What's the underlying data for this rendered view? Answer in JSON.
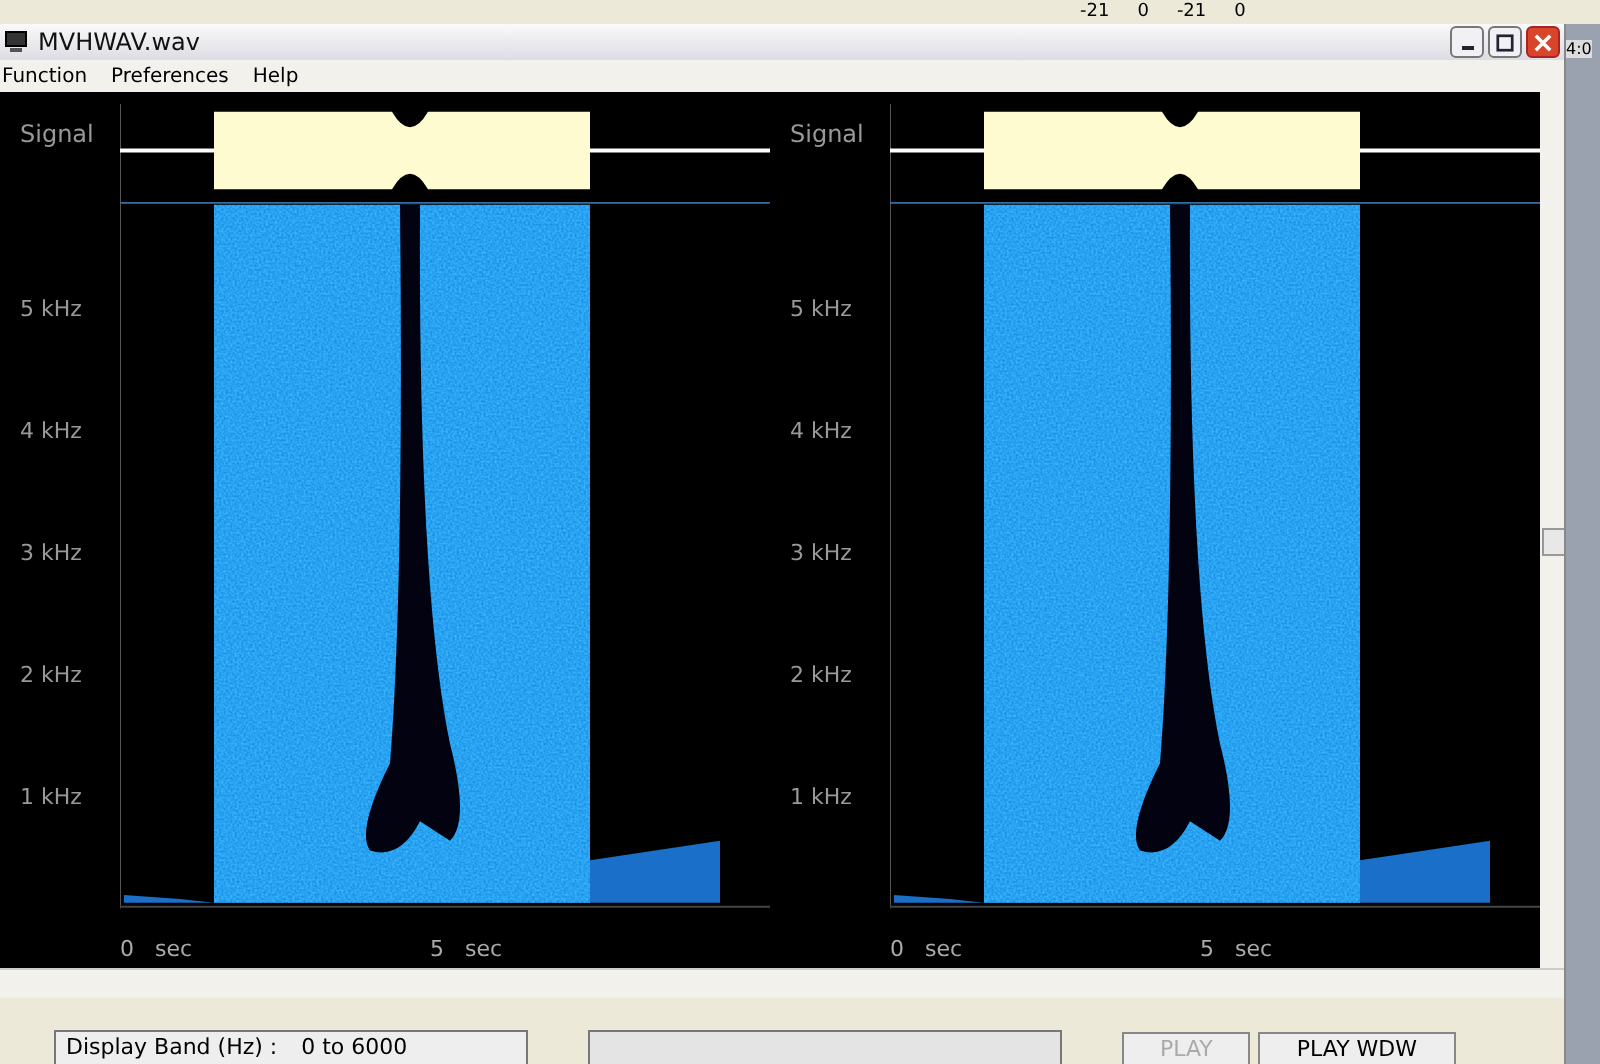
{
  "top_toolbar": {
    "readouts": [
      "-21",
      "0",
      "-21",
      "0"
    ],
    "clock": "4:0"
  },
  "window": {
    "title": "MVHWAV.wav"
  },
  "menu": [
    "Function",
    "Preferences",
    "Help"
  ],
  "panels": [
    {
      "signal_label": "Signal",
      "y_labels": [
        "5 kHz",
        "4 kHz",
        "3 kHz",
        "2 kHz",
        "1 kHz"
      ],
      "x_labels": [
        "0   sec",
        "5   sec"
      ]
    },
    {
      "signal_label": "Signal",
      "y_labels": [
        "5 kHz",
        "4 kHz",
        "3 kHz",
        "2 kHz",
        "1 kHz"
      ],
      "x_labels": [
        "0   sec",
        "5   sec"
      ]
    }
  ],
  "bottom": {
    "band_label": "Display Band (Hz) :",
    "band_value": "0 to 6000",
    "buttons": [
      {
        "label": "PLAY",
        "disabled": true
      },
      {
        "label": "PLAY WDW",
        "disabled": false
      }
    ]
  }
}
